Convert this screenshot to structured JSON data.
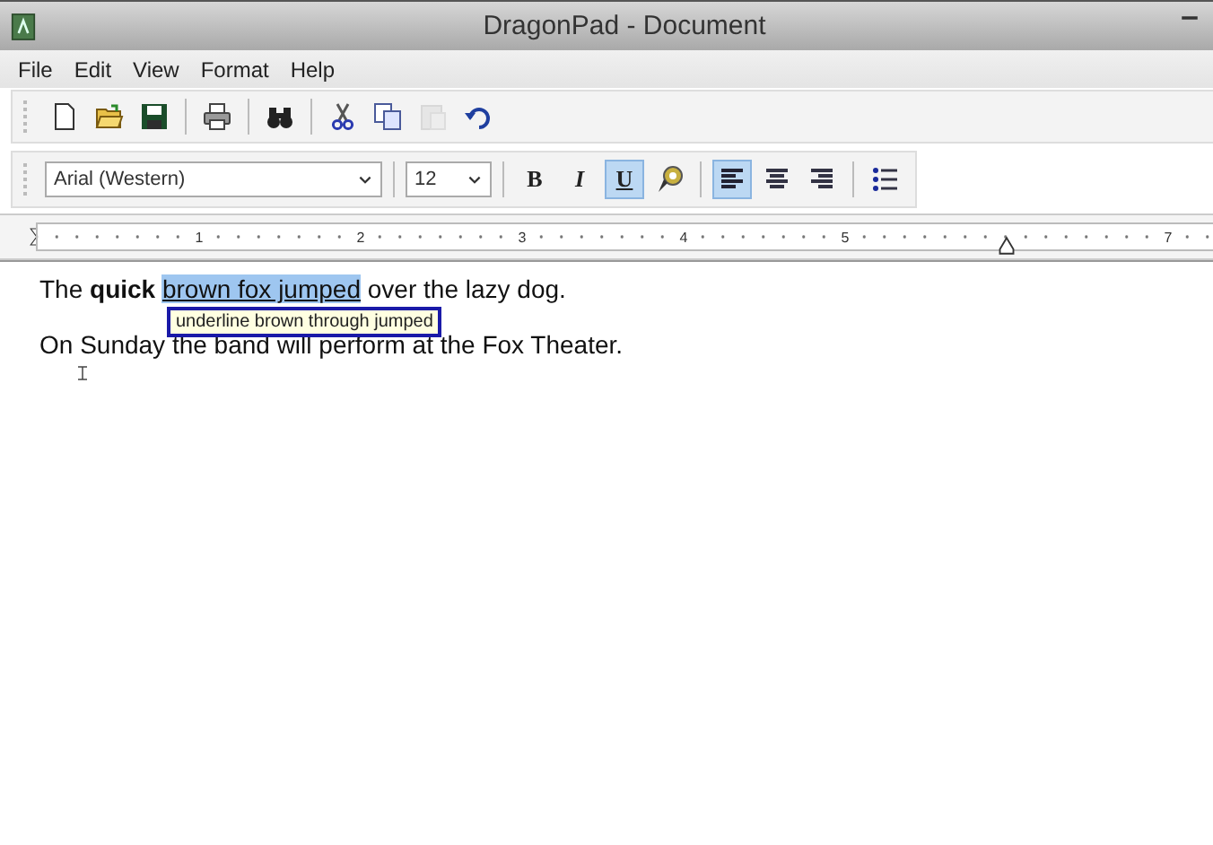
{
  "window": {
    "title": "DragonPad - Document"
  },
  "menu": [
    {
      "label": "File"
    },
    {
      "label": "Edit"
    },
    {
      "label": "View"
    },
    {
      "label": "Format"
    },
    {
      "label": "Help"
    }
  ],
  "toolbar": [
    {
      "kind": "new",
      "disabled": false
    },
    {
      "kind": "open",
      "disabled": false
    },
    {
      "kind": "save",
      "disabled": false
    },
    {
      "kind": "sep"
    },
    {
      "kind": "print",
      "disabled": false
    },
    {
      "kind": "sep"
    },
    {
      "kind": "find",
      "disabled": false
    },
    {
      "kind": "sep"
    },
    {
      "kind": "cut",
      "disabled": false
    },
    {
      "kind": "copy",
      "disabled": false
    },
    {
      "kind": "paste",
      "disabled": true
    },
    {
      "kind": "undo",
      "disabled": false
    }
  ],
  "format_bar": {
    "font": "Arial (Western)",
    "size": "12",
    "buttons": [
      {
        "kind": "text",
        "label": "B",
        "selected": false
      },
      {
        "kind": "text",
        "label": "I",
        "selected": false
      },
      {
        "kind": "text",
        "label": "U",
        "selected": true
      },
      {
        "kind": "highlight",
        "selected": false
      },
      {
        "kind": "sep"
      },
      {
        "kind": "align-left",
        "selected": true
      },
      {
        "kind": "align-center",
        "selected": false
      },
      {
        "kind": "align-right",
        "selected": false
      },
      {
        "kind": "sep"
      },
      {
        "kind": "bullets",
        "selected": false
      }
    ]
  },
  "ruler": [
    {
      "kind": "number",
      "label": "1"
    },
    {
      "kind": "number",
      "label": "2"
    },
    {
      "kind": "number",
      "label": "3"
    },
    {
      "kind": "number",
      "label": "4"
    },
    {
      "kind": "number",
      "label": "5"
    },
    {
      "kind": "indent-marker"
    },
    {
      "kind": "number",
      "label": "7"
    }
  ],
  "document": {
    "paragraphs": [
      [
        {
          "text": "The ",
          "bold": false,
          "selected": false
        },
        {
          "text": "quick ",
          "bold": true,
          "selected": false
        },
        {
          "text": "brown fox jumped",
          "bold": false,
          "selected": true
        },
        {
          "text": " over the lazy dog.",
          "bold": false,
          "selected": false
        }
      ],
      [
        {
          "text": "On Sunday the band will perform at the Fox Theater.",
          "bold": false,
          "selected": false
        }
      ]
    ],
    "tooltip": "underline brown through jumped"
  }
}
